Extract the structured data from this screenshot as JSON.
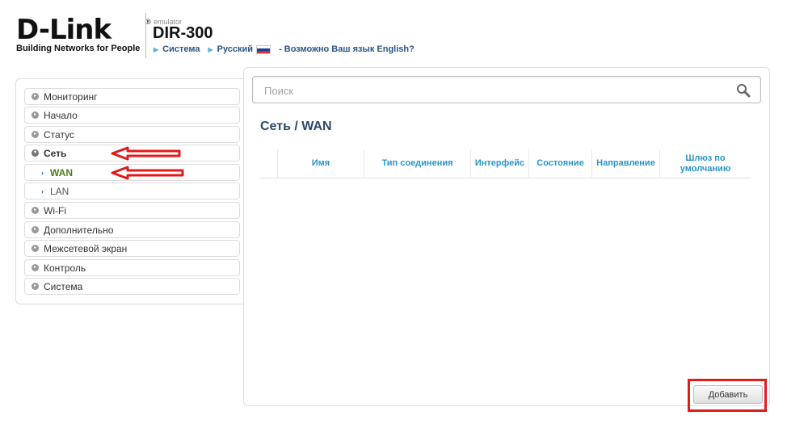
{
  "header": {
    "brand": "D-Link",
    "brand_mark": "®",
    "tagline": "Building Networks for People",
    "emulator_label": "emulator",
    "model": "DIR-300",
    "breadcrumb": {
      "system": "Система",
      "language": "Русский",
      "english_prompt": "- Возможно Ваш язык English?"
    }
  },
  "sidebar": {
    "items": [
      {
        "label": "Мониторинг"
      },
      {
        "label": "Начало"
      },
      {
        "label": "Статус"
      },
      {
        "label": "Сеть"
      },
      {
        "label": "WAN"
      },
      {
        "label": "LAN"
      },
      {
        "label": "Wi-Fi"
      },
      {
        "label": "Дополнительно"
      },
      {
        "label": "Межсетевой экран"
      },
      {
        "label": "Контроль"
      },
      {
        "label": "Система"
      }
    ]
  },
  "search": {
    "placeholder": "Поиск"
  },
  "page": {
    "title": "Сеть /  WAN"
  },
  "table": {
    "columns": [
      "",
      "Имя",
      "Тип соединения",
      "Интерфейс",
      "Состояние",
      "Направление",
      "Шлюз по умолчанию"
    ]
  },
  "actions": {
    "add_label": "Добавить"
  },
  "colors": {
    "accent": "#2a95c9",
    "active_item": "#4a7c1a",
    "annotation_red": "#e01b1b"
  },
  "icons": {
    "search": "search-icon",
    "collapsed": "circle-arrow-icon",
    "expanded": "circle-chevron-down-icon",
    "sub": "arrow-right-icon"
  }
}
